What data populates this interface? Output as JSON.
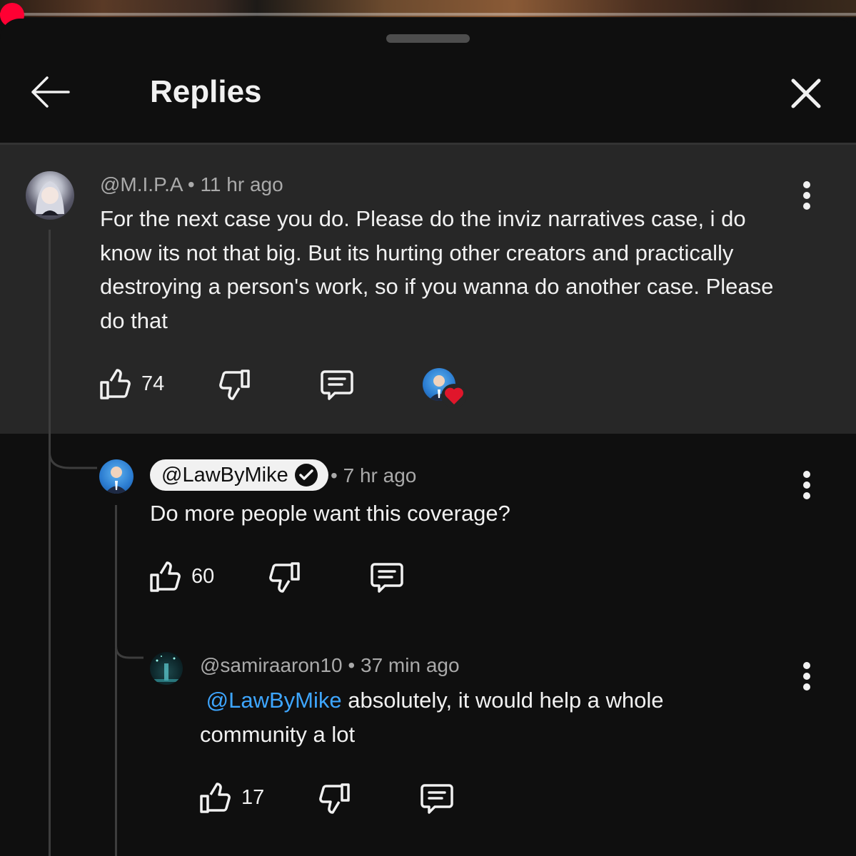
{
  "header": {
    "title": "Replies"
  },
  "progress": {
    "fraction": 0.015
  },
  "comments": [
    {
      "handle": "@M.I.P.A",
      "time": "11 hr ago",
      "text": "For the next case you do. Please do the inviz narratives case, i do know its not that big. But its hurting other creators and practically destroying a person's work, so if you wanna do another case. Please do that",
      "likes": "74",
      "creator_heart": true
    },
    {
      "handle": "@LawByMike",
      "verified": true,
      "time": "7 hr ago",
      "text": "Do more people want this coverage?",
      "likes": "60"
    },
    {
      "handle": "@samiraaron10",
      "time": "37 min ago",
      "mention": "@LawByMike",
      "text": "absolutely, it would help a whole community a lot",
      "likes": "17"
    }
  ],
  "meta_separator": "•",
  "colors": {
    "accent": "#ff0033",
    "mention": "#3ea6ff",
    "heart": "#e0162b",
    "highlight_bg": "#272727"
  }
}
